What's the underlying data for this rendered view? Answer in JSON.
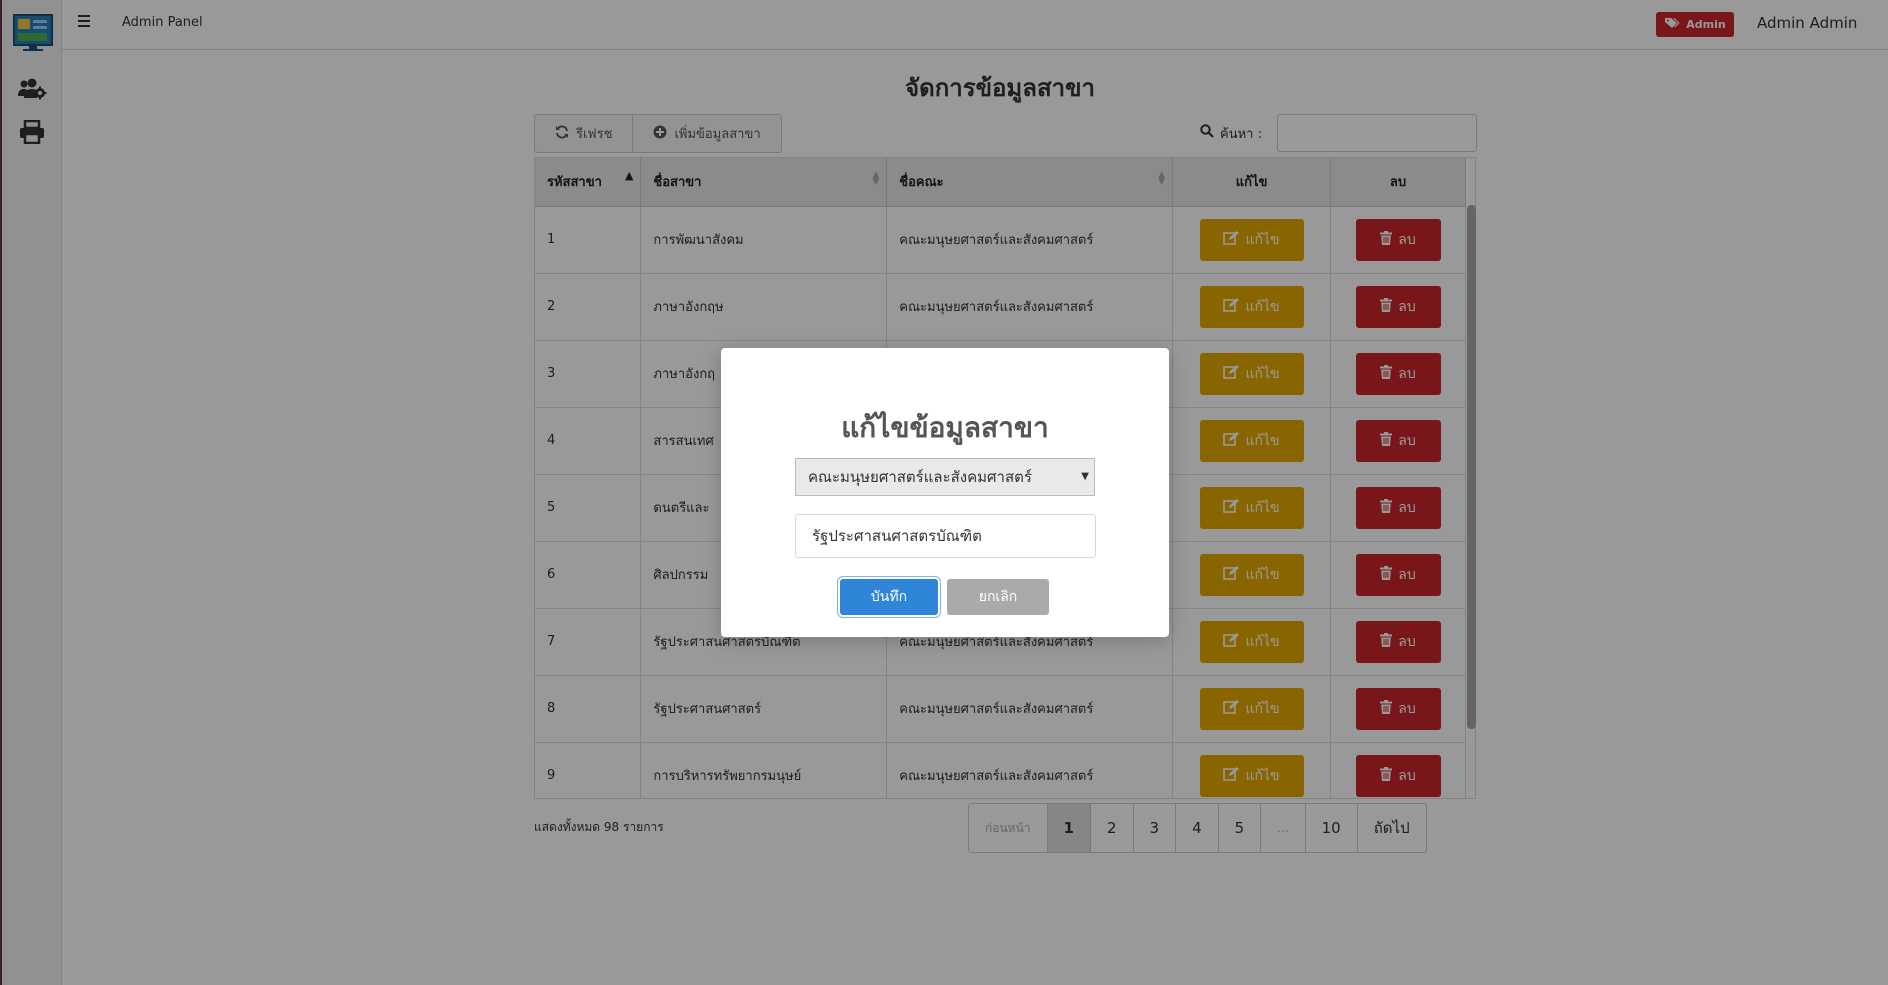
{
  "topbar": {
    "brand": "Admin Panel",
    "role_badge": "Admin",
    "username": "Admin Admin"
  },
  "sidebar": {
    "items": [
      {
        "icon": "users-gear-icon"
      },
      {
        "icon": "printer-icon"
      }
    ]
  },
  "page": {
    "title": "จัดการข้อมูลสาขา",
    "refresh_label": "รีเฟรช",
    "add_label": "เพิ่มข้อมูลสาขา",
    "search_label": "ค้นหา :"
  },
  "table": {
    "headers": {
      "code": "รหัสสาขา",
      "branch": "ชื่อสาขา",
      "faculty": "ชื่อคณะ",
      "edit": "แก้ไข",
      "delete": "ลบ"
    },
    "edit_label": "แก้ไข",
    "delete_label": "ลบ",
    "rows": [
      {
        "code": "1",
        "branch": "การพัฒนาสังคม",
        "faculty": "คณะมนุษยศาสตร์และสังคมศาสตร์"
      },
      {
        "code": "2",
        "branch": "ภาษาอังกฤษ",
        "faculty": "คณะมนุษยศาสตร์และสังคมศาสตร์"
      },
      {
        "code": "3",
        "branch": "ภาษาอังกฤ",
        "faculty": ""
      },
      {
        "code": "4",
        "branch": "สารสนเทศ",
        "faculty": ""
      },
      {
        "code": "5",
        "branch": "ดนตรีและ",
        "faculty": ""
      },
      {
        "code": "6",
        "branch": "ศิลปกรรม",
        "faculty": ""
      },
      {
        "code": "7",
        "branch": "รัฐประศาสนศาสตรบัณฑิต",
        "faculty": "คณะมนุษยศาสตร์และสังคมศาสตร์"
      },
      {
        "code": "8",
        "branch": "รัฐประศาสนศาสตร์",
        "faculty": "คณะมนุษยศาสตร์และสังคมศาสตร์"
      },
      {
        "code": "9",
        "branch": "การบริหารทรัพยากรมนุษย์",
        "faculty": "คณะมนุษยศาสตร์และสังคมศาสตร์"
      }
    ]
  },
  "footer": {
    "info": "แสดงทั้งหมด 98 รายการ",
    "pagination": [
      "ก่อนหน้า",
      "1",
      "2",
      "3",
      "4",
      "5",
      "...",
      "10",
      "ถัดไป"
    ],
    "active_page": "1"
  },
  "modal": {
    "title": "แก้ไขข้อมูลสาขา",
    "faculty_selected": "คณะมนุษยศาสตร์และสังคมศาสตร์",
    "branch_value": "รัฐประศาสนศาสตรบัณฑิต",
    "save_label": "บันทึก",
    "cancel_label": "ยกเลิก"
  },
  "colors": {
    "edit": "#e5a800",
    "delete": "#c9252c",
    "primary": "#2f85d8",
    "badge": "#c9252c"
  }
}
